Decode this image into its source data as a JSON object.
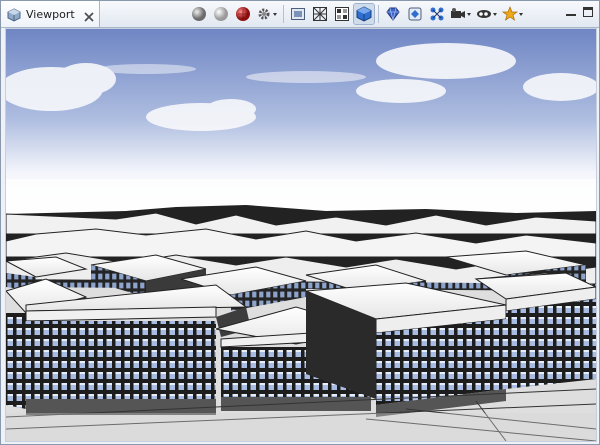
{
  "window": {
    "tab_title": "Viewport"
  },
  "icons": {
    "view": "viewport-cube-icon",
    "close": "close-icon",
    "toolbar": [
      "sphere-gray-icon",
      "sphere-light-icon",
      "sphere-red-checker-icon",
      "settings-gear-dropdown-icon",
      "render-frame-icon",
      "wireframe-icon",
      "texture-grid-icon",
      "solid-cube-icon",
      "gem-icon",
      "scene-object-icon",
      "node-network-icon",
      "camera-dropdown-icon",
      "visibility-dropdown-icon",
      "bookmark-star-dropdown-icon"
    ],
    "minimize": "minimize-icon",
    "maximize": "maximize-icon"
  },
  "colors": {
    "frame_border": "#8a98ad",
    "sky_top": "#6f86c4",
    "sky_horizon": "#ffffff",
    "building_roof": "#f4f4f4",
    "building_wall": "#2a2a2a",
    "window_glass": "#9fb3d8",
    "ground": "#dcdcdc",
    "accent_active": "#cfdcec"
  }
}
